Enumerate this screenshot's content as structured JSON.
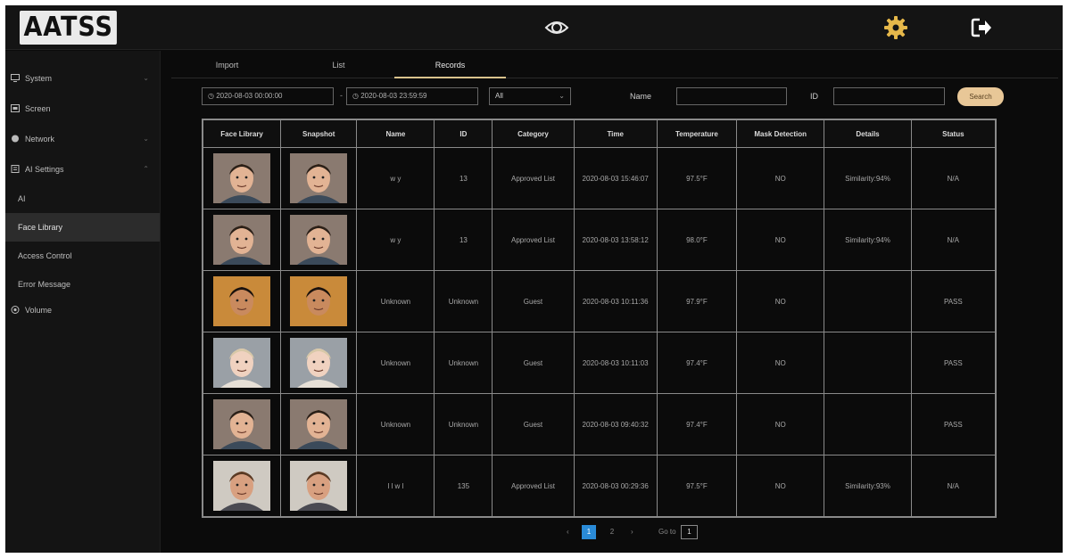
{
  "header": {
    "logo_text": "AATSS",
    "icons": [
      "eye-icon",
      "gear-icon",
      "logout-icon"
    ]
  },
  "sidebar": {
    "items": [
      {
        "label": "System",
        "icon": "monitor-icon"
      },
      {
        "label": "Screen",
        "icon": "screen-icon"
      },
      {
        "label": "Network",
        "icon": "network-icon"
      },
      {
        "label": "AI Settings",
        "icon": "ai-settings-icon"
      }
    ],
    "sub_items": [
      "AI",
      "Face Library",
      "Access Control",
      "Error Message"
    ],
    "active_sub": "Face Library",
    "last_item": {
      "label": "Volume",
      "icon": "volume-icon"
    }
  },
  "tabs": [
    "Import",
    "List",
    "Records"
  ],
  "active_tab": "Records",
  "filters": {
    "start_datetime": "2020-08-03 00:00:00",
    "end_datetime": "2020-08-03 23:59:59",
    "separator": "-",
    "category_select": "All",
    "name_label": "Name",
    "name_value": "",
    "id_label": "ID",
    "id_value": "",
    "search_label": "Search"
  },
  "table": {
    "columns": [
      "Face Library",
      "Snapshot",
      "Name",
      "ID",
      "Category",
      "Time",
      "Temperature",
      "Mask Detection",
      "Details",
      "Status"
    ],
    "rows": [
      {
        "name": "w y",
        "id": "13",
        "category": "Approved List",
        "time": "2020-08-03 15:46:07",
        "temperature": "97.5°F",
        "mask": "NO",
        "details": "Similarity:94%",
        "status": "N/A"
      },
      {
        "name": "w y",
        "id": "13",
        "category": "Approved List",
        "time": "2020-08-03 13:58:12",
        "temperature": "98.0°F",
        "mask": "NO",
        "details": "Similarity:94%",
        "status": "N/A"
      },
      {
        "name": "Unknown",
        "id": "Unknown",
        "category": "Guest",
        "time": "2020-08-03 10:11:36",
        "temperature": "97.9°F",
        "mask": "NO",
        "details": "",
        "status": "PASS"
      },
      {
        "name": "Unknown",
        "id": "Unknown",
        "category": "Guest",
        "time": "2020-08-03 10:11:03",
        "temperature": "97.4°F",
        "mask": "NO",
        "details": "",
        "status": "PASS"
      },
      {
        "name": "Unknown",
        "id": "Unknown",
        "category": "Guest",
        "time": "2020-08-03 09:40:32",
        "temperature": "97.4°F",
        "mask": "NO",
        "details": "",
        "status": "PASS"
      },
      {
        "name": "l l w l",
        "id": "135",
        "category": "Approved List",
        "time": "2020-08-03 00:29:36",
        "temperature": "97.5°F",
        "mask": "NO",
        "details": "Similarity:93%",
        "status": "N/A"
      }
    ]
  },
  "pagination": {
    "prev": "‹",
    "pages": [
      "1",
      "2"
    ],
    "current": "1",
    "next": "›",
    "goto_label": "Go to",
    "goto_value": "1"
  },
  "colors": {
    "accent": "#d9c28c",
    "search_button": "#e8c797",
    "active_page": "#2a8bd8",
    "gear": "#e6b84a"
  }
}
